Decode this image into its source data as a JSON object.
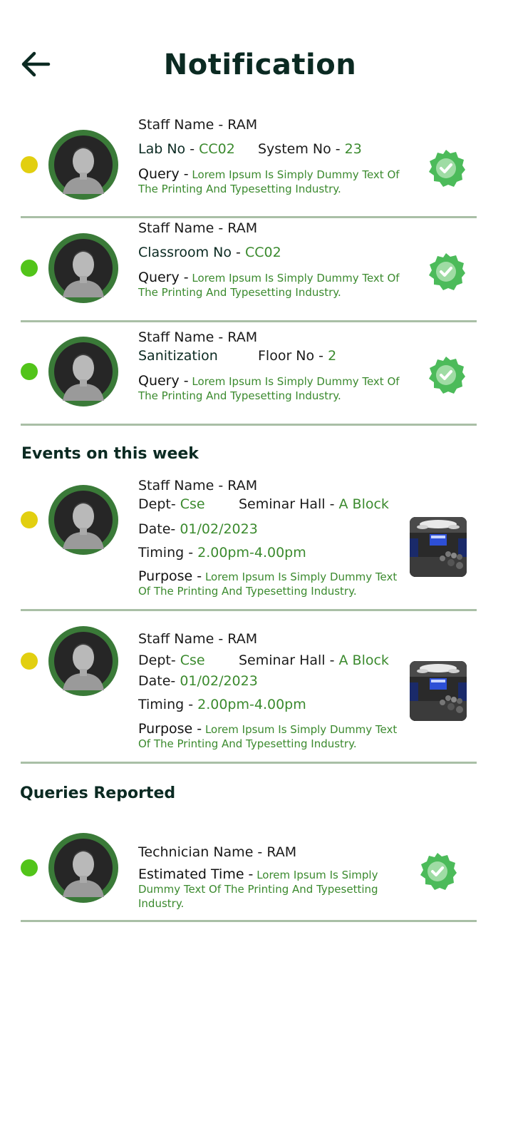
{
  "header": {
    "title": "Notification"
  },
  "notifications": [
    {
      "status_color": "#e2cf10",
      "staff": "Staff Name - RAM",
      "field1_label": "Lab No",
      "field1_sep": " - ",
      "field1_value": "CC02",
      "field2_label": "System No - ",
      "field2_value": "23",
      "query_label": "Query -",
      "query_text": "Lorem Ipsum Is Simply Dummy Text Of The Printing And Typesetting Industry."
    },
    {
      "status_color": "#52c41a",
      "staff": "Staff Name - RAM",
      "field1_label": "Classroom No",
      "field1_sep": " - ",
      "field1_value": "CC02",
      "query_label": "Query -",
      "query_text": "Lorem Ipsum Is Simply Dummy Text Of The Printing And Typesetting Industry."
    },
    {
      "status_color": "#52c41a",
      "staff": "Staff Name - RAM",
      "field1_label": "Sanitization",
      "field2_label": "Floor No - ",
      "field2_value": "2",
      "query_label": "Query -",
      "query_text": "Lorem Ipsum Is Simply Dummy Text Of The Printing And Typesetting Industry."
    }
  ],
  "events_section": {
    "title": "Events on this week",
    "items": [
      {
        "staff": "Staff Name - RAM",
        "dept_label": "Dept- ",
        "dept_value": "Cse",
        "hall_label": "Seminar Hall - ",
        "hall_value": "A Block",
        "date_label": "Date- ",
        "date_value": "01/02/2023",
        "timing_label": "Timing - ",
        "timing_value": "2.00pm-4.00pm",
        "purpose_label": "Purpose -",
        "purpose_text": "Lorem Ipsum Is Simply Dummy Text Of The Printing And Typesetting Industry."
      },
      {
        "staff": "Staff Name - RAM",
        "dept_label": "Dept- ",
        "dept_value": "Cse",
        "hall_label": "Seminar Hall - ",
        "hall_value": "A Block",
        "date_label": "Date- ",
        "date_value": "01/02/2023",
        "timing_label": "Timing - ",
        "timing_value": "2.00pm-4.00pm",
        "purpose_label": "Purpose -",
        "purpose_text": "Lorem Ipsum Is Simply Dummy Text Of The Printing And Typesetting Industry."
      }
    ]
  },
  "queries_section": {
    "title": "Queries Reported",
    "items": [
      {
        "technician": "Technician Name - RAM",
        "eta_label": "Estimated Time -",
        "eta_text": "Lorem Ipsum Is Simply Dummy Text Of The Printing And Typesetting Industry."
      }
    ]
  },
  "colors": {
    "accent_green": "#3b8a2e",
    "avatar_ring": "#3a7a38",
    "badge_green": "#4cbb5a",
    "status_yellow": "#e2cf10",
    "status_green": "#52c41a",
    "divider": "#a9bfa6",
    "title_dark": "#0b2a22"
  },
  "icons": {
    "back": "arrow-left-icon",
    "verified": "verified-badge-icon",
    "avatar": "user-photo",
    "event_photo": "seminar-hall-photo"
  }
}
